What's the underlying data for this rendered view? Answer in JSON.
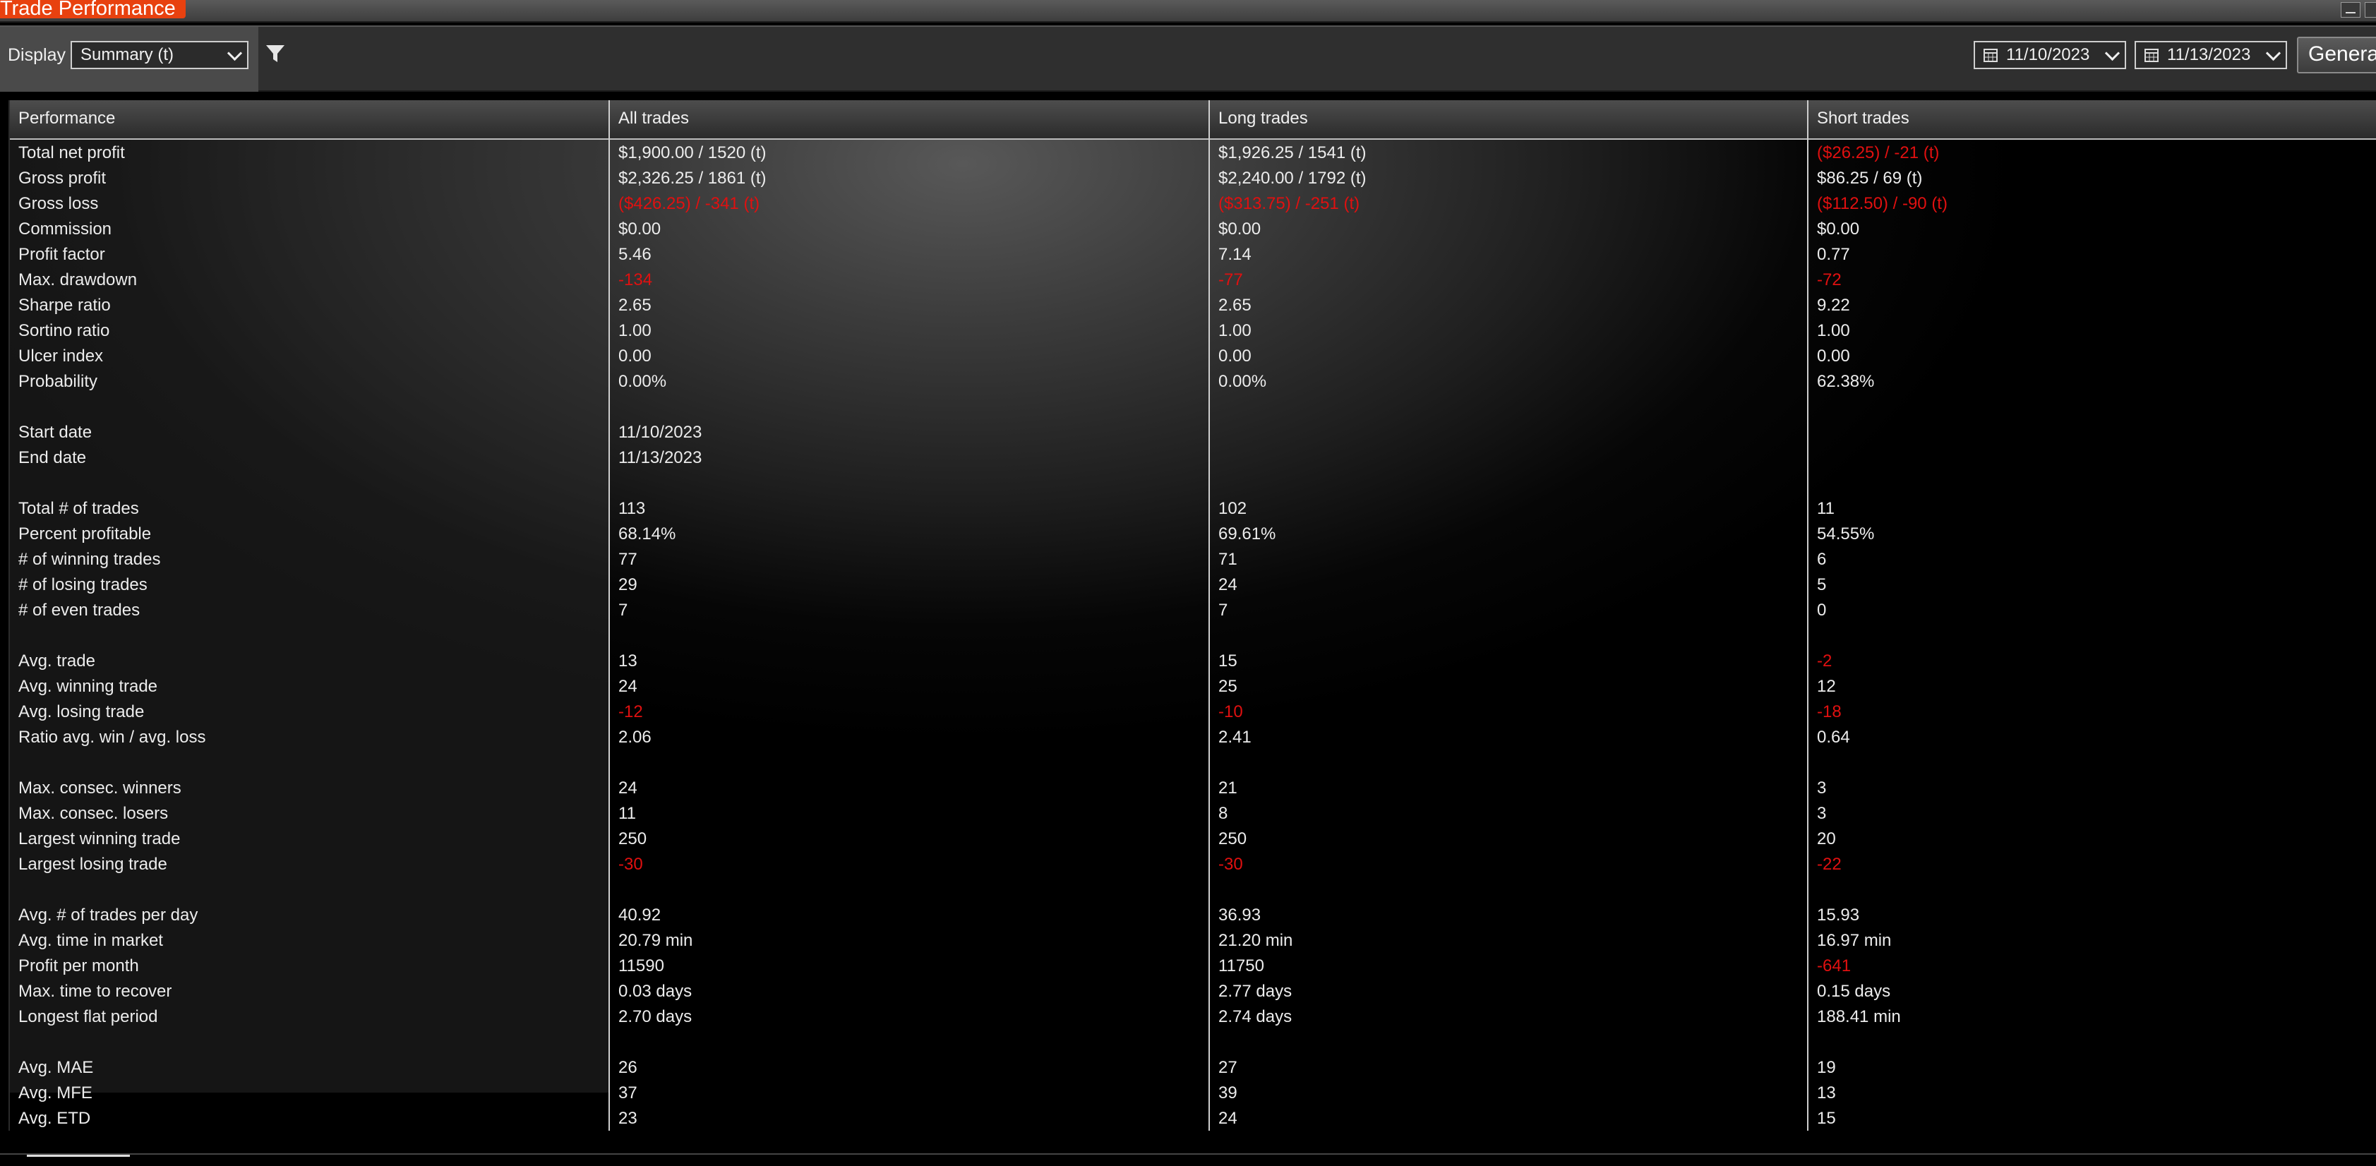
{
  "window": {
    "title": "Trade Performance"
  },
  "toolbar": {
    "display_label": "Display",
    "display_value": "Summary (t)",
    "date_from": "11/10/2023",
    "date_to": "11/13/2023",
    "generate_label": "Generate"
  },
  "grid": {
    "columns": [
      "Performance",
      "All trades",
      "Long trades",
      "Short trades"
    ],
    "rows": [
      {
        "label": "Total net profit",
        "all": "$1,900.00 / 1520 (t)",
        "long": "$1,926.25 / 1541 (t)",
        "short": "($26.25) / -21 (t)",
        "neg": [
          false,
          false,
          true
        ]
      },
      {
        "label": "Gross profit",
        "all": "$2,326.25 / 1861 (t)",
        "long": "$2,240.00 / 1792 (t)",
        "short": "$86.25 / 69 (t)",
        "neg": [
          false,
          false,
          false
        ]
      },
      {
        "label": "Gross loss",
        "all": "($426.25) / -341 (t)",
        "long": "($313.75) / -251 (t)",
        "short": "($112.50) / -90 (t)",
        "neg": [
          true,
          true,
          true
        ]
      },
      {
        "label": "Commission",
        "all": "$0.00",
        "long": "$0.00",
        "short": "$0.00",
        "neg": [
          false,
          false,
          false
        ]
      },
      {
        "label": "Profit factor",
        "all": "5.46",
        "long": "7.14",
        "short": "0.77",
        "neg": [
          false,
          false,
          false
        ]
      },
      {
        "label": "Max. drawdown",
        "all": "-134",
        "long": "-77",
        "short": "-72",
        "neg": [
          true,
          true,
          true
        ]
      },
      {
        "label": "Sharpe ratio",
        "all": "2.65",
        "long": "2.65",
        "short": "9.22",
        "neg": [
          false,
          false,
          false
        ]
      },
      {
        "label": "Sortino ratio",
        "all": "1.00",
        "long": "1.00",
        "short": "1.00",
        "neg": [
          false,
          false,
          false
        ]
      },
      {
        "label": "Ulcer index",
        "all": "0.00",
        "long": "0.00",
        "short": "0.00",
        "neg": [
          false,
          false,
          false
        ]
      },
      {
        "label": "Probability",
        "all": "0.00%",
        "long": "0.00%",
        "short": "62.38%",
        "neg": [
          false,
          false,
          false
        ]
      },
      {
        "blank": true
      },
      {
        "label": "Start date",
        "all": "11/10/2023",
        "long": "",
        "short": "",
        "neg": [
          false,
          false,
          false
        ]
      },
      {
        "label": "End date",
        "all": "11/13/2023",
        "long": "",
        "short": "",
        "neg": [
          false,
          false,
          false
        ]
      },
      {
        "blank": true
      },
      {
        "label": "Total # of trades",
        "all": "113",
        "long": "102",
        "short": "11",
        "neg": [
          false,
          false,
          false
        ]
      },
      {
        "label": "Percent profitable",
        "all": "68.14%",
        "long": "69.61%",
        "short": "54.55%",
        "neg": [
          false,
          false,
          false
        ]
      },
      {
        "label": "# of winning trades",
        "all": "77",
        "long": "71",
        "short": "6",
        "neg": [
          false,
          false,
          false
        ]
      },
      {
        "label": "# of losing trades",
        "all": "29",
        "long": "24",
        "short": "5",
        "neg": [
          false,
          false,
          false
        ]
      },
      {
        "label": "# of even trades",
        "all": "7",
        "long": "7",
        "short": "0",
        "neg": [
          false,
          false,
          false
        ]
      },
      {
        "blank": true
      },
      {
        "label": "Avg. trade",
        "all": "13",
        "long": "15",
        "short": "-2",
        "neg": [
          false,
          false,
          true
        ]
      },
      {
        "label": "Avg. winning trade",
        "all": "24",
        "long": "25",
        "short": "12",
        "neg": [
          false,
          false,
          false
        ]
      },
      {
        "label": "Avg. losing trade",
        "all": "-12",
        "long": "-10",
        "short": "-18",
        "neg": [
          true,
          true,
          true
        ]
      },
      {
        "label": "Ratio avg. win / avg. loss",
        "all": "2.06",
        "long": "2.41",
        "short": "0.64",
        "neg": [
          false,
          false,
          false
        ]
      },
      {
        "blank": true
      },
      {
        "label": "Max. consec. winners",
        "all": "24",
        "long": "21",
        "short": "3",
        "neg": [
          false,
          false,
          false
        ]
      },
      {
        "label": "Max. consec. losers",
        "all": "11",
        "long": "8",
        "short": "3",
        "neg": [
          false,
          false,
          false
        ]
      },
      {
        "label": "Largest winning trade",
        "all": "250",
        "long": "250",
        "short": "20",
        "neg": [
          false,
          false,
          false
        ]
      },
      {
        "label": "Largest losing trade",
        "all": "-30",
        "long": "-30",
        "short": "-22",
        "neg": [
          true,
          true,
          true
        ]
      },
      {
        "blank": true
      },
      {
        "label": "Avg. # of trades per day",
        "all": "40.92",
        "long": "36.93",
        "short": "15.93",
        "neg": [
          false,
          false,
          false
        ]
      },
      {
        "label": "Avg. time in market",
        "all": "20.79 min",
        "long": "21.20 min",
        "short": "16.97 min",
        "neg": [
          false,
          false,
          false
        ]
      },
      {
        "label": "Profit per month",
        "all": "11590",
        "long": "11750",
        "short": "-641",
        "neg": [
          false,
          false,
          true
        ]
      },
      {
        "label": "Max. time to recover",
        "all": "0.03 days",
        "long": "2.77 days",
        "short": "0.15 days",
        "neg": [
          false,
          false,
          false
        ]
      },
      {
        "label": "Longest flat period",
        "all": "2.70 days",
        "long": "2.74 days",
        "short": "188.41 min",
        "neg": [
          false,
          false,
          false
        ]
      },
      {
        "blank": true
      },
      {
        "label": "Avg. MAE",
        "all": "26",
        "long": "27",
        "short": "19",
        "neg": [
          false,
          false,
          false
        ]
      },
      {
        "label": "Avg. MFE",
        "all": "37",
        "long": "39",
        "short": "13",
        "neg": [
          false,
          false,
          false
        ]
      },
      {
        "label": "Avg. ETD",
        "all": "23",
        "long": "24",
        "short": "15",
        "neg": [
          false,
          false,
          false
        ]
      }
    ]
  },
  "colors": {
    "title_accent": "#e8410f",
    "negative": "#e01010"
  },
  "icons": {
    "filter": "filter-funnel-icon",
    "calendar": "calendar-icon"
  }
}
